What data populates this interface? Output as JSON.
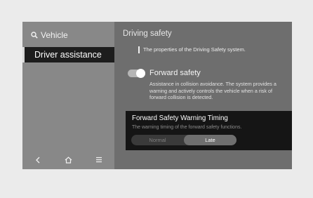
{
  "sidebar": {
    "header_label": "Vehicle",
    "header_icon": "search-icon",
    "selected_item": "Driver assistance"
  },
  "nav": {
    "icons": [
      "back-icon",
      "home-icon",
      "menu-icon"
    ]
  },
  "main": {
    "title": "Driving safety",
    "description": "The properties of the Driving Safety system.",
    "forward_safety": {
      "label": "Forward safety",
      "enabled": true,
      "description": "Assistance in collision avoidance. The system provides a warning and actively controls the vehicle when a risk of  forward collision is detected."
    },
    "timing": {
      "title": "Forward Safety Warning Timing",
      "description": "The warning timing of the forward safety functions.",
      "options": [
        "Normal",
        "Late"
      ],
      "selected": "Late"
    }
  }
}
